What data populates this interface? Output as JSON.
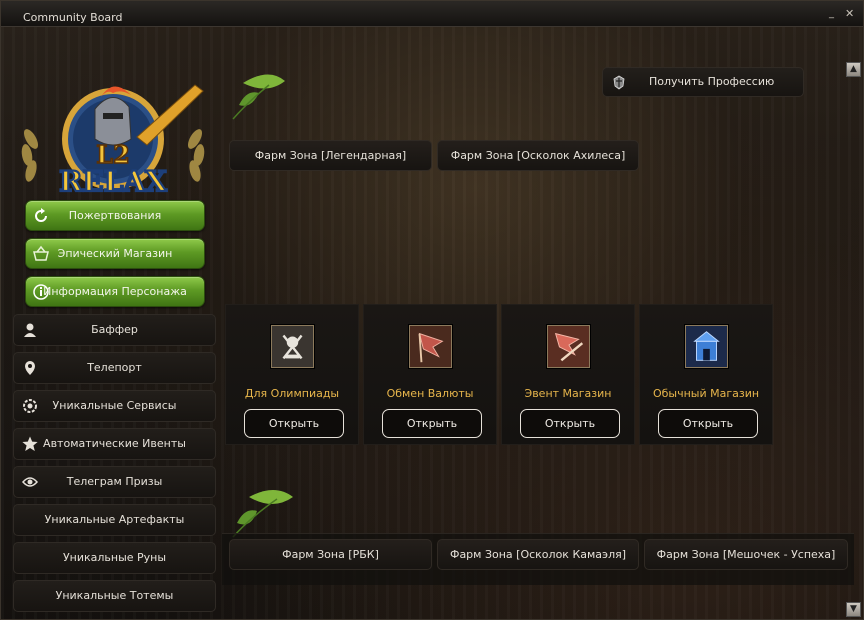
{
  "window": {
    "title": "Community Board",
    "minimize_glyph": "_",
    "close_glyph": "✕"
  },
  "logo": {
    "text_top": "L2",
    "text_bottom": "RELAX"
  },
  "green_menu": [
    {
      "label": "Пожертвования",
      "icon": "refresh-icon"
    },
    {
      "label": "Эпический Магазин",
      "icon": "basket-icon"
    },
    {
      "label": "Информация Персонажа",
      "icon": "info-icon"
    }
  ],
  "side_menu": [
    {
      "label": "Баффер",
      "icon": "person-icon"
    },
    {
      "label": "Телепорт",
      "icon": "map-pin-icon"
    },
    {
      "label": "Уникальные Сервисы",
      "icon": "gear-icon"
    },
    {
      "label": "Автоматические Ивенты",
      "icon": "star-icon"
    },
    {
      "label": "Телеграм Призы",
      "icon": "eye-icon"
    },
    {
      "label": "Уникальные Артефакты",
      "icon": ""
    },
    {
      "label": "Уникальные Руны",
      "icon": ""
    },
    {
      "label": "Уникальные Тотемы",
      "icon": ""
    }
  ],
  "top": {
    "profession_button": "Получить Профессию",
    "farm_zones": [
      "Фарм Зона [Легендарная]",
      "Фарм Зона [Осколок Ахилеса]"
    ]
  },
  "shops": [
    {
      "title": "Для Олимпиады",
      "button": "Открыть",
      "icon": "olympiad-crest-icon"
    },
    {
      "title": "Обмен Валюты",
      "button": "Открыть",
      "icon": "red-flag-icon"
    },
    {
      "title": "Эвент Магазин",
      "button": "Открыть",
      "icon": "flag-sword-icon"
    },
    {
      "title": "Обычный Магазин",
      "button": "Открыть",
      "icon": "blue-castle-icon"
    }
  ],
  "bottom": {
    "farm_zones": [
      "Фарм Зона [РБК]",
      "Фарм Зона [Осколок Камаэля]",
      "Фарм Зона [Мешочек - Успеха]"
    ]
  },
  "scroll": {
    "up": "▲",
    "down": "▼"
  },
  "colors": {
    "green_button": "#5e9a24",
    "shop_title": "#e7b64c",
    "background": "#1e1914"
  }
}
